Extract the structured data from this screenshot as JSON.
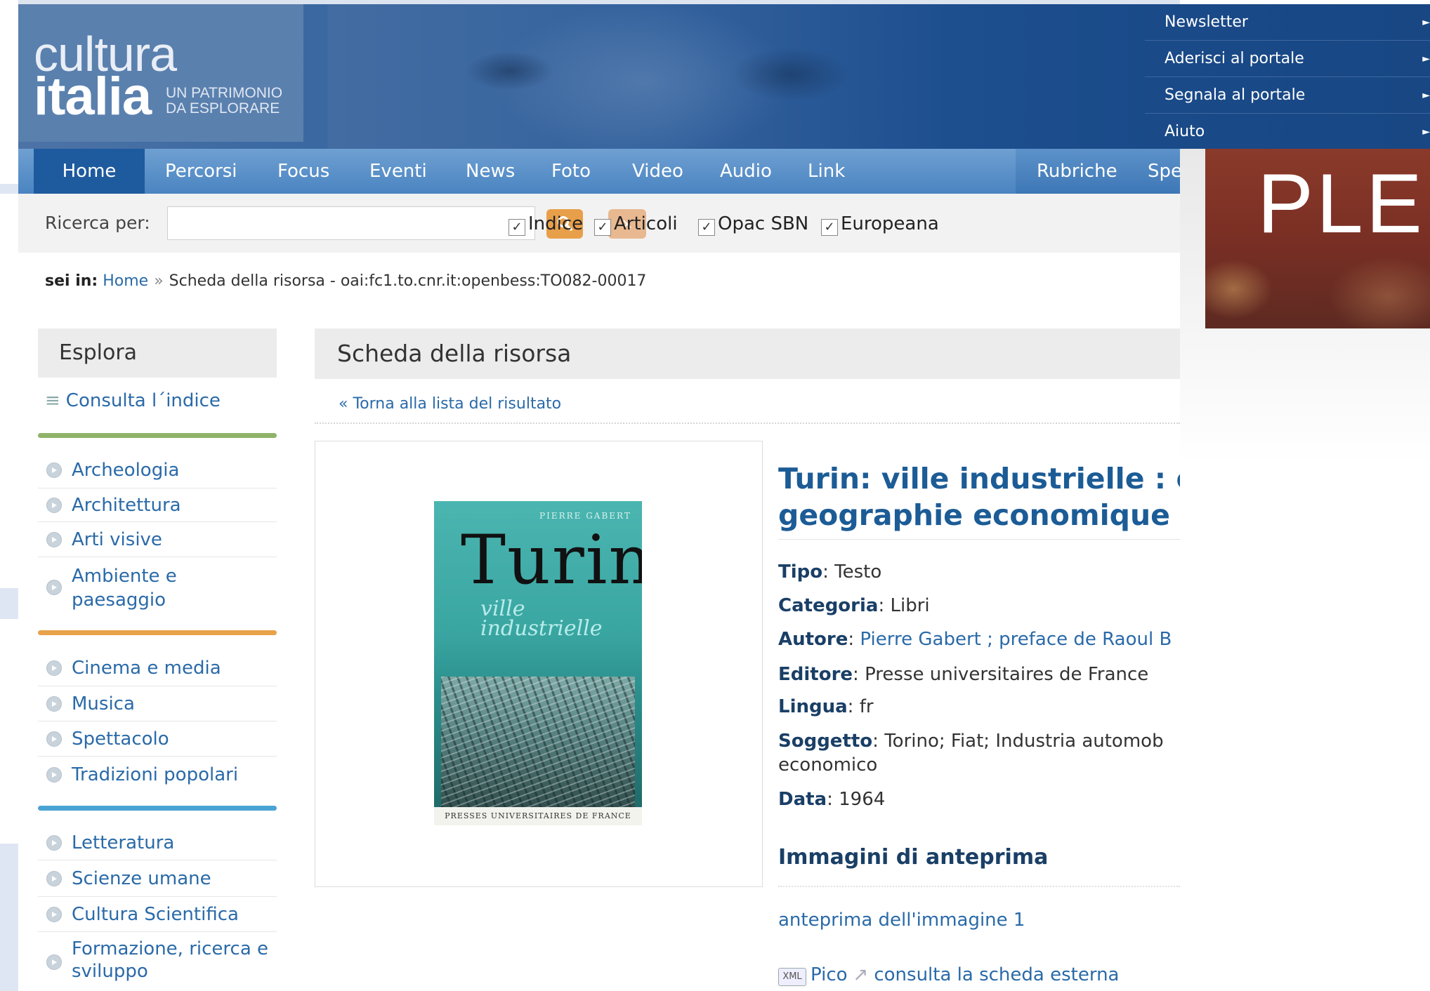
{
  "header": {
    "logo_line1": "cultura",
    "logo_line2": "italia",
    "logo_tag1": "UN PATRIMONIO",
    "logo_tag2": "DA ESPLORARE",
    "toplinks": [
      "Newsletter",
      "Aderisci al portale",
      "Segnala al portale",
      "Aiuto"
    ]
  },
  "nav": {
    "items": [
      "Home",
      "Percorsi",
      "Focus",
      "Eventi",
      "News",
      "Foto",
      "Video",
      "Audio",
      "Link"
    ],
    "right_items": [
      "Rubriche",
      "Spe"
    ],
    "active": "Home"
  },
  "search": {
    "label": "Ricerca per:",
    "value": "",
    "search_icon": "magnifier-icon",
    "clear_icon": "x-icon",
    "clear_glyph": "×",
    "checkboxes": [
      {
        "label": "Indice",
        "checked": true
      },
      {
        "label": "Articoli",
        "checked": true
      },
      {
        "label": "Opac SBN",
        "checked": true
      },
      {
        "label": "Europeana",
        "checked": true
      }
    ]
  },
  "breadcrumb": {
    "prefix": "sei in:",
    "home": "Home",
    "sep": "»",
    "current": "Scheda della risorsa - oai:fc1.to.cnr.it:openbess:TO082-00017"
  },
  "sidebar": {
    "title": "Esplora",
    "index_link": "Consulta l´indice",
    "group_colors": [
      "#8fb36a",
      "#e8a24a",
      "#4aa3d3"
    ],
    "groups": [
      [
        "Archeologia",
        "Architettura",
        "Arti visive",
        "Ambiente e paesaggio"
      ],
      [
        "Cinema e media",
        "Musica",
        "Spettacolo",
        "Tradizioni popolari"
      ],
      [
        "Letteratura",
        "Scienze umane",
        "Cultura Scientifica",
        "Formazione, ricerca e sviluppo"
      ]
    ]
  },
  "main": {
    "title": "Scheda della risorsa",
    "back_link": "« Torna alla lista del risultato",
    "cover": {
      "author": "PIERRE GABERT",
      "title": "Turin",
      "subtitle1": "ville",
      "subtitle2": "industrielle",
      "publisher": "PRESSES UNIVERSITAIRES DE FRANCE"
    },
    "resource_title_line1": "Turin: ville industrielle : et",
    "resource_title_line2": "geographie economique et",
    "fields": [
      {
        "label": "Tipo",
        "value": "Testo"
      },
      {
        "label": "Categoria",
        "value": "Libri"
      },
      {
        "label": "Autore",
        "value": "Pierre Gabert ; preface de Raoul B"
      },
      {
        "label": "Editore",
        "value": "Presse universitaires de France"
      },
      {
        "label": "Lingua",
        "value": "fr"
      },
      {
        "label": "Soggetto",
        "value": "Torino; Fiat; Industria automob",
        "value2": "economico"
      },
      {
        "label": "Data",
        "value": "1964"
      }
    ],
    "preview_title": "Immagini di anteprima",
    "preview_link": "anteprima dell'immagine 1",
    "pico_badge": "XML",
    "pico_label": "Pico",
    "external_link": "consulta la scheda esterna"
  },
  "overlay": {
    "text": "PLE"
  }
}
